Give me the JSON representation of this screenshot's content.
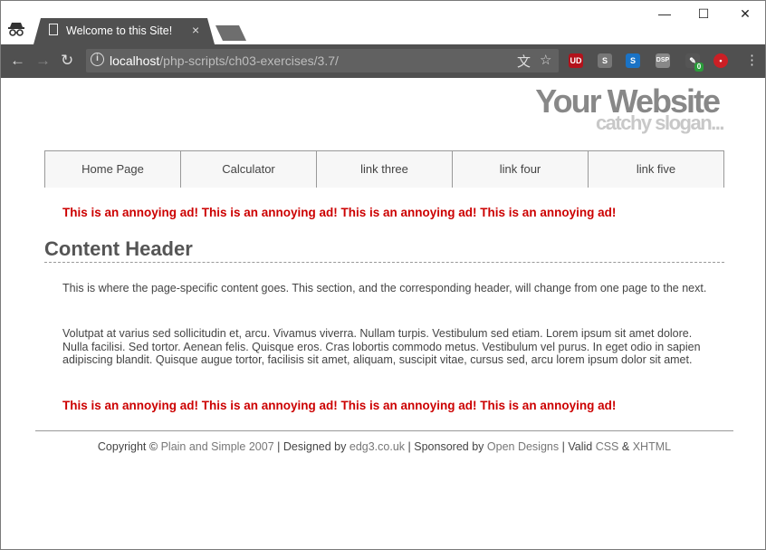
{
  "browser": {
    "tab_title": "Welcome to this Site!",
    "tab_close": "×",
    "url_host": "localhost",
    "url_path": "/php-scripts/ch03-exercises/3.7/",
    "window_controls": {
      "minimize": "—",
      "maximize": "☐",
      "close": "✕"
    },
    "nav": {
      "back": "←",
      "forward": "→",
      "reload": "↻"
    },
    "extensions": [
      {
        "name": "ublock",
        "label": "UD",
        "color": "#b3121b"
      },
      {
        "name": "s-ext-grey",
        "label": "S",
        "color": "#777777"
      },
      {
        "name": "s-ext-blue",
        "label": "S",
        "color": "#1a73c6"
      },
      {
        "name": "dsp-ext",
        "label": "DSP",
        "color": "#888888"
      },
      {
        "name": "wappalyzer",
        "label": "0",
        "color": "#2a9d3a"
      },
      {
        "name": "lastpass",
        "label": "•",
        "color": "#cc1f25"
      }
    ]
  },
  "site": {
    "title": "Your Website",
    "slogan": "catchy slogan..."
  },
  "nav": {
    "items": [
      "Home Page",
      "Calculator",
      "link three",
      "link four",
      "link five"
    ]
  },
  "ads": {
    "top": "This is an annoying ad! This is an annoying ad! This is an annoying ad! This is an annoying ad!",
    "bottom": "This is an annoying ad! This is an annoying ad! This is an annoying ad! This is an annoying ad!"
  },
  "content": {
    "header": "Content Header",
    "paragraph1": "This is where the page-specific content goes. This section, and the corresponding header, will change from one page to the next.",
    "paragraph2": "Volutpat at varius sed sollicitudin et, arcu. Vivamus viverra. Nullam turpis. Vestibulum sed etiam. Lorem ipsum sit amet dolore. Nulla facilisi. Sed tortor. Aenean felis. Quisque eros. Cras lobortis commodo metus. Vestibulum vel purus. In eget odio in sapien adipiscing blandit. Quisque augue tortor, facilisis sit amet, aliquam, suscipit vitae, cursus sed, arcu lorem ipsum dolor sit amet."
  },
  "footer": {
    "copyright": "Copyright ©",
    "plain_simple": "Plain and Simple 2007",
    "sep1": "|",
    "designed_by": "Designed by",
    "designer": "edg3.co.uk",
    "sep2": "|",
    "sponsored_by": "Sponsored by",
    "sponsor": "Open Designs",
    "sep3": "|",
    "valid": "Valid",
    "css": "CSS",
    "amp": "&",
    "xhtml": "XHTML"
  }
}
